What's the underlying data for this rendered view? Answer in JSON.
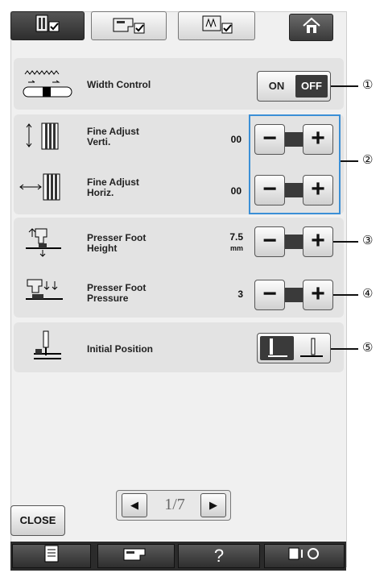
{
  "tabs": [
    {
      "icon": "utility-settings-icon",
      "active": true
    },
    {
      "icon": "sewing-machine-settings-icon",
      "active": false
    },
    {
      "icon": "embroidery-settings-icon",
      "active": false
    }
  ],
  "home": {
    "icon": "home-icon"
  },
  "width_control": {
    "label": "Width Control",
    "on": "ON",
    "off": "OFF",
    "callout": "①"
  },
  "fine_vert": {
    "label1": "Fine Adjust",
    "label2": "Verti.",
    "value": "00"
  },
  "fine_horiz": {
    "label1": "Fine Adjust",
    "label2": "Horiz.",
    "value": "00"
  },
  "fine_callout": "②",
  "presser_height": {
    "label1": "Presser Foot",
    "label2": "Height",
    "value": "7.5",
    "unit": "mm",
    "callout": "③"
  },
  "presser_pressure": {
    "label1": "Presser Foot",
    "label2": "Pressure",
    "value": "3",
    "callout": "④"
  },
  "initial_position": {
    "label": "Initial Position",
    "callout": "⑤"
  },
  "stepper": {
    "minus": "−",
    "plus": "+"
  },
  "pager": {
    "page": "1",
    "sep": "/",
    "total": "7",
    "prev": "◀",
    "next": "▶"
  },
  "close": "CLOSE",
  "bottom": {
    "help": "?"
  }
}
